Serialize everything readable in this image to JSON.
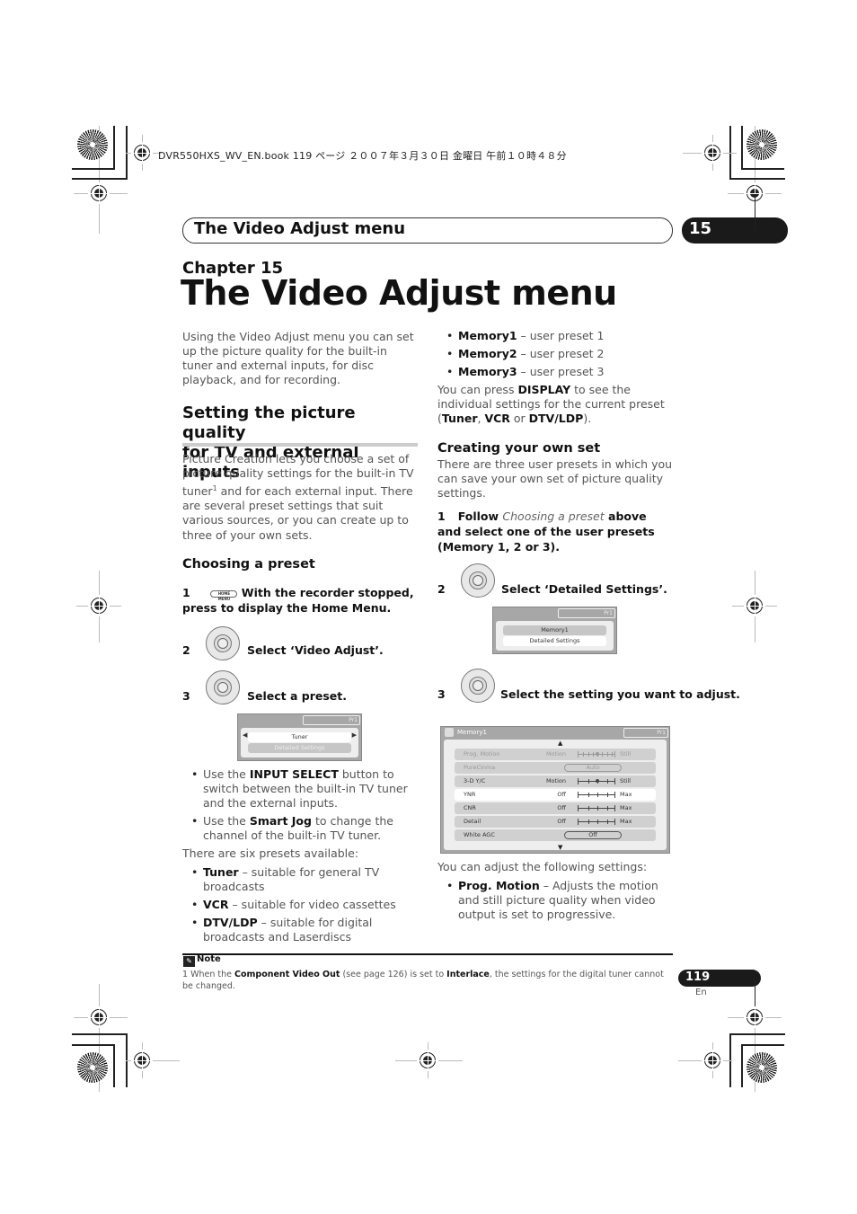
{
  "printer_line": "DVR550HXS_WV_EN.book  119 ページ  ２００７年３月３０日  金曜日  午前１０時４８分",
  "header": {
    "running_title": "The Video Adjust menu",
    "chapter_number": "15"
  },
  "chapter": {
    "label": "Chapter 15",
    "title": "The Video Adjust menu"
  },
  "intro": "Using the Video Adjust menu you can set up the picture quality for the built-in tuner and external inputs, for disc playback, and for recording.",
  "section": {
    "heading_line1": "Setting the picture quality",
    "heading_line2": "for TV and external inputs",
    "para_a": "Picture Creation lets you choose a set of picture quality settings for the built-in TV tuner",
    "para_sup": "1",
    "para_b": " and for each external input. There are several preset settings that suit various sources, or you can create up to three of your own sets."
  },
  "choosing": {
    "heading": "Choosing a preset",
    "step1_num": "1",
    "step1_icon": "HOME MENU",
    "step1_text": "With the recorder stopped, press to display the Home Menu.",
    "step2_num": "2",
    "step2_text": "Select ‘Video Adjust’.",
    "step3_num": "3",
    "step3_text": "Select a preset.",
    "osd": {
      "pr": "Pr1",
      "preset": "Tuner",
      "detailed": "Detailed Settings"
    },
    "bullets": [
      {
        "pre": "Use the ",
        "bold": "INPUT SELECT",
        "post": " button to switch between the built-in TV tuner and the external inputs."
      },
      {
        "pre": "Use the ",
        "bold": "Smart Jog",
        "post": " to change the channel of the built-in TV tuner."
      }
    ],
    "presets_intro": "There are six presets available:",
    "presets": [
      {
        "name": "Tuner",
        "desc": " – suitable for general TV broadcasts"
      },
      {
        "name": "VCR",
        "desc": " – suitable for video cassettes"
      },
      {
        "name": "DTV/LDP",
        "desc": " – suitable for digital broadcasts and Laserdiscs"
      },
      {
        "name": "Memory1",
        "desc": " – user preset 1"
      },
      {
        "name": "Memory2",
        "desc": " – user preset 2"
      },
      {
        "name": "Memory3",
        "desc": " – user preset 3"
      }
    ],
    "display_note": {
      "t1": "You can press ",
      "b1": "DISPLAY",
      "t2": " to see the individual settings for the current preset (",
      "b2": "Tuner",
      "t3": ", ",
      "b3": "VCR",
      "t4": " or ",
      "b4": "DTV/LDP",
      "t5": ")."
    }
  },
  "creating": {
    "heading": "Creating your own set",
    "intro": "There are three user presets in which you can save your own set of picture quality settings.",
    "step1_num": "1",
    "step1_a": "Follow ",
    "step1_italic": "Choosing a preset",
    "step1_b": " above and select one of the user presets (Memory 1, 2 or 3).",
    "step2_num": "2",
    "step2_text": "Select ‘Detailed Settings’.",
    "osd2": {
      "pr": "Pr1",
      "preset": "Memory1",
      "detailed": "Detailed Settings"
    },
    "step3_num": "3",
    "step3_text": "Select the setting you want to adjust.",
    "osd3": {
      "title": "Memory1",
      "pr": "Pr1",
      "rows": [
        {
          "label": "Prog. Motion",
          "left": "Motion",
          "right": "Still",
          "type": "slider",
          "state": "disabled",
          "position": 0.5
        },
        {
          "label": "PureCinma",
          "value": "Auto",
          "type": "pill",
          "state": "disabled"
        },
        {
          "label": "3-D Y/C",
          "left": "Motion",
          "right": "Still",
          "type": "slider",
          "state": "normal",
          "position": 0.5
        },
        {
          "label": "YNR",
          "left": "Off",
          "right": "Max",
          "type": "slider",
          "state": "selected"
        },
        {
          "label": "CNR",
          "left": "Off",
          "right": "Max",
          "type": "slider",
          "state": "normal"
        },
        {
          "label": "Detail",
          "left": "Off",
          "right": "Max",
          "type": "slider",
          "state": "normal"
        },
        {
          "label": "White AGC",
          "value": "Off",
          "type": "pill",
          "state": "normal"
        }
      ]
    },
    "adjust_intro": "You can adjust the following settings:",
    "adjust_items": [
      {
        "name": "Prog. Motion",
        "desc": " – Adjusts the motion and still picture quality when video output is set to progressive."
      }
    ]
  },
  "note": {
    "icon": "pencil-icon",
    "title": "Note",
    "n": "1 ",
    "t1": "When the ",
    "b1": "Component Video Out",
    "t2": " (see page 126) is set to ",
    "b2": "Interlace",
    "t3": ", the settings for the digital tuner cannot be changed."
  },
  "footer": {
    "page_number": "119",
    "language": "En"
  }
}
